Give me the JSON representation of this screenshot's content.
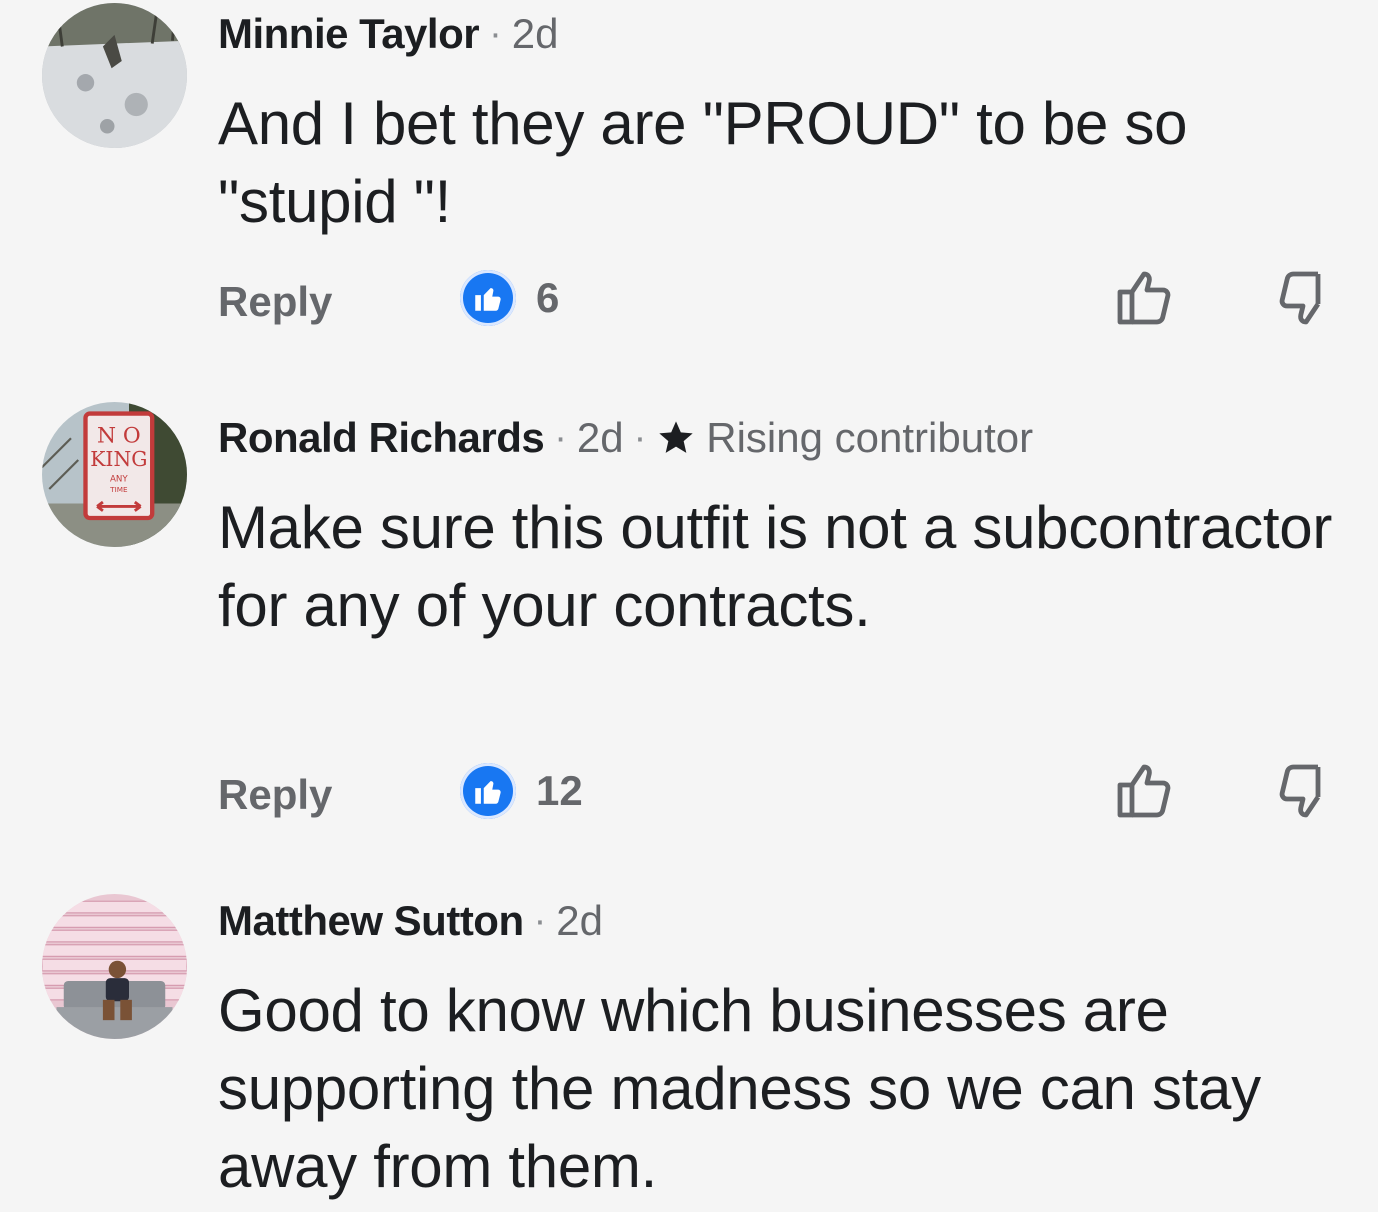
{
  "comments": [
    {
      "author": "Minnie Taylor",
      "time": "2d",
      "text": "And I bet they are \"PROUD\" to be so \"stupid \"!",
      "reply_label": "Reply",
      "like_count": "6"
    },
    {
      "author": "Ronald Richards",
      "time": "2d",
      "badge": "Rising contributor",
      "text": "Make sure this outfit is not a subcontractor for any of your contracts.",
      "reply_label": "Reply",
      "like_count": "12"
    },
    {
      "author": "Matthew Sutton",
      "time": "2d",
      "text": "Good to know which businesses are supporting the madness so we can stay away from them."
    }
  ],
  "separator": "·",
  "colors": {
    "like_blue": "#1877f2",
    "meta_gray": "#65676b",
    "background": "#f5f5f5"
  },
  "icons": {
    "like_reaction": "thumbs-up-icon",
    "upvote": "thumbs-up-outline-icon",
    "downvote": "thumbs-down-outline-icon",
    "badge": "star-icon"
  }
}
